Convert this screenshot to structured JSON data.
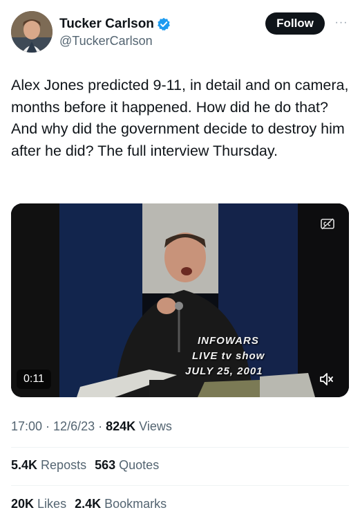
{
  "header": {
    "display_name": "Tucker Carlson",
    "handle": "@TuckerCarlson",
    "follow_label": "Follow",
    "more_label": "···"
  },
  "tweet": {
    "text": "Alex Jones predicted 9-11, in detail and on camera, months before it happened. How did he do that? And why did the government decide to destroy him after he did? The full interview Thursday."
  },
  "media": {
    "overlay_line1": "INFOWARS",
    "overlay_line2": "LIVE tv show",
    "overlay_line3": "JULY 25, 2001",
    "timer": "0:11"
  },
  "meta": {
    "time": "17:00",
    "separator": " · ",
    "date": "12/6/23",
    "views_count": "824K",
    "views_label": "Views"
  },
  "stats_row1": {
    "reposts_count": "5.4K",
    "reposts_label": "Reposts",
    "quotes_count": "563",
    "quotes_label": "Quotes"
  },
  "stats_row2": {
    "likes_count": "20K",
    "likes_label": "Likes",
    "bookmarks_count": "2.4K",
    "bookmarks_label": "Bookmarks"
  },
  "colors": {
    "accent_verified": "#1d9bf0",
    "text_primary": "#0f1419",
    "text_secondary": "#536471"
  },
  "icons": [
    "verified-badge-icon",
    "more-icon",
    "cc-icon",
    "mute-icon"
  ]
}
